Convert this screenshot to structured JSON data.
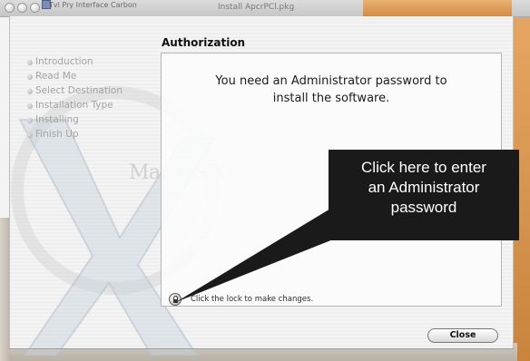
{
  "topbar": {
    "background_window_title": "Tvl Pry Interface Carbon",
    "installer_title": "Install ApcrPCl.pkg"
  },
  "watermark": {
    "text": "Mac OS X"
  },
  "installer": {
    "pane_title": "Authorization",
    "steps": [
      {
        "label": "Introduction"
      },
      {
        "label": "Read Me"
      },
      {
        "label": "Select Destination"
      },
      {
        "label": "Installation Type"
      },
      {
        "label": "Installing"
      },
      {
        "label": "Finish Up"
      }
    ],
    "message_line1": "You need an Administrator password to",
    "message_line2": "install the software.",
    "lock_hint": "Click the lock to make changes.",
    "close_label": "Close"
  },
  "callout": {
    "line1": "Click here to enter",
    "line2": "an Administrator",
    "line3": "password"
  },
  "colors": {
    "callout_bg": "#1a1a1a",
    "callout_text": "#ffffff",
    "background_accent": "#d48b44"
  }
}
